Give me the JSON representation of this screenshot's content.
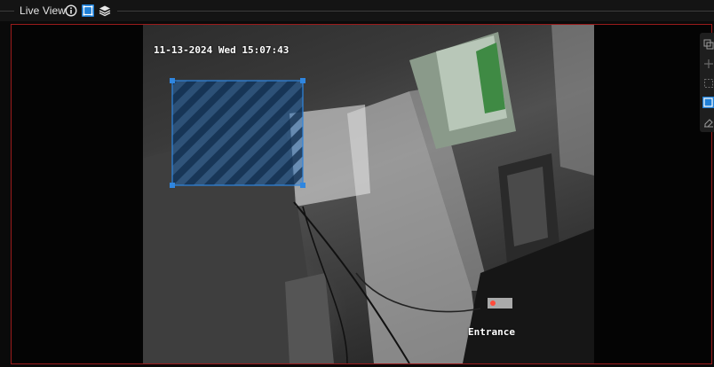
{
  "header": {
    "title": "Live View"
  },
  "video": {
    "timestamp": "11-13-2024 Wed 15:07:43",
    "channel_name": "Entrance"
  },
  "icons": {
    "info": "info-icon",
    "region": "region-draw-icon",
    "layers": "layers-icon"
  },
  "colors": {
    "accent": "#1f7fd6",
    "frame_border": "#9b1b1b",
    "region_fill": "#1f6fc4"
  }
}
